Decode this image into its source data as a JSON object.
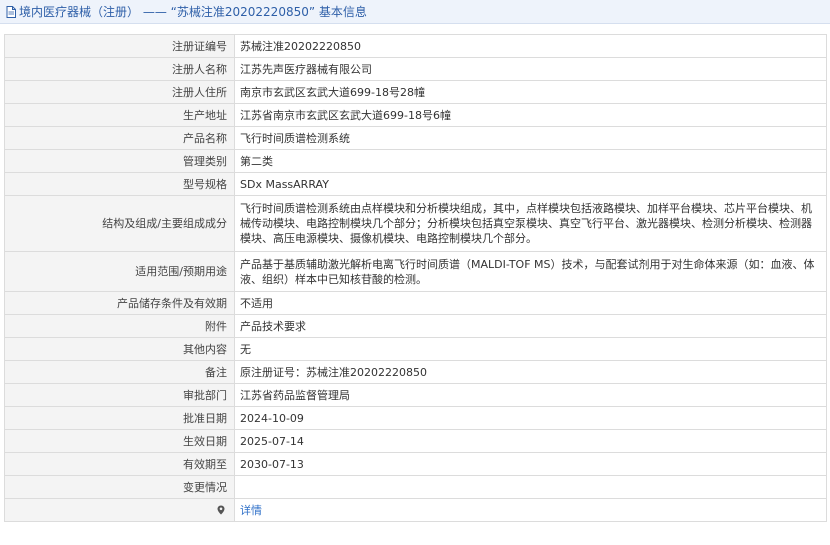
{
  "header": {
    "title_part1": "境内医疗器械（注册）",
    "separator": " —— ",
    "title_part2": "“苏械注准20202220850”",
    "title_part3": " 基本信息"
  },
  "rows": [
    {
      "label": "注册证编号",
      "value": "苏械注准20202220850"
    },
    {
      "label": "注册人名称",
      "value": "江苏先声医疗器械有限公司"
    },
    {
      "label": "注册人住所",
      "value": "南京市玄武区玄武大道699-18号28幢"
    },
    {
      "label": "生产地址",
      "value": "江苏省南京市玄武区玄武大道699-18号6幢"
    },
    {
      "label": "产品名称",
      "value": "飞行时间质谱检测系统"
    },
    {
      "label": "管理类别",
      "value": "第二类"
    },
    {
      "label": "型号规格",
      "value": "SDx MassARRAY"
    },
    {
      "label": "结构及组成/主要组成成分",
      "value": "飞行时间质谱检测系统由点样模块和分析模块组成，其中，点样模块包括液路模块、加样平台模块、芯片平台模块、机械传动模块、电路控制模块几个部分；分析模块包括真空泵模块、真空飞行平台、激光器模块、检测分析模块、检测器模块、高压电源模块、摄像机模块、电路控制模块几个部分。"
    },
    {
      "label": "适用范围/预期用途",
      "value": "产品基于基质辅助激光解析电离飞行时间质谱（MALDI-TOF MS）技术，与配套试剂用于对生命体来源（如：血液、体液、组织）样本中已知核苷酸的检测。"
    },
    {
      "label": "产品储存条件及有效期",
      "value": "不适用"
    },
    {
      "label": "附件",
      "value": "产品技术要求"
    },
    {
      "label": "其他内容",
      "value": "无"
    },
    {
      "label": "备注",
      "value": "原注册证号：苏械注准20202220850"
    },
    {
      "label": "审批部门",
      "value": "江苏省药品监督管理局"
    },
    {
      "label": "批准日期",
      "value": "2024-10-09"
    },
    {
      "label": "生效日期",
      "value": "2025-07-14"
    },
    {
      "label": "有效期至",
      "value": "2030-07-13"
    },
    {
      "label": "变更情况",
      "value": ""
    }
  ],
  "detail_row": {
    "link_text": "详情"
  },
  "icons": {
    "header": "document-icon",
    "detail": "location-pin-icon"
  },
  "colors": {
    "header_text": "#2e5fa8",
    "link": "#2e6fc8",
    "label_bg": "#f4f4f4"
  }
}
